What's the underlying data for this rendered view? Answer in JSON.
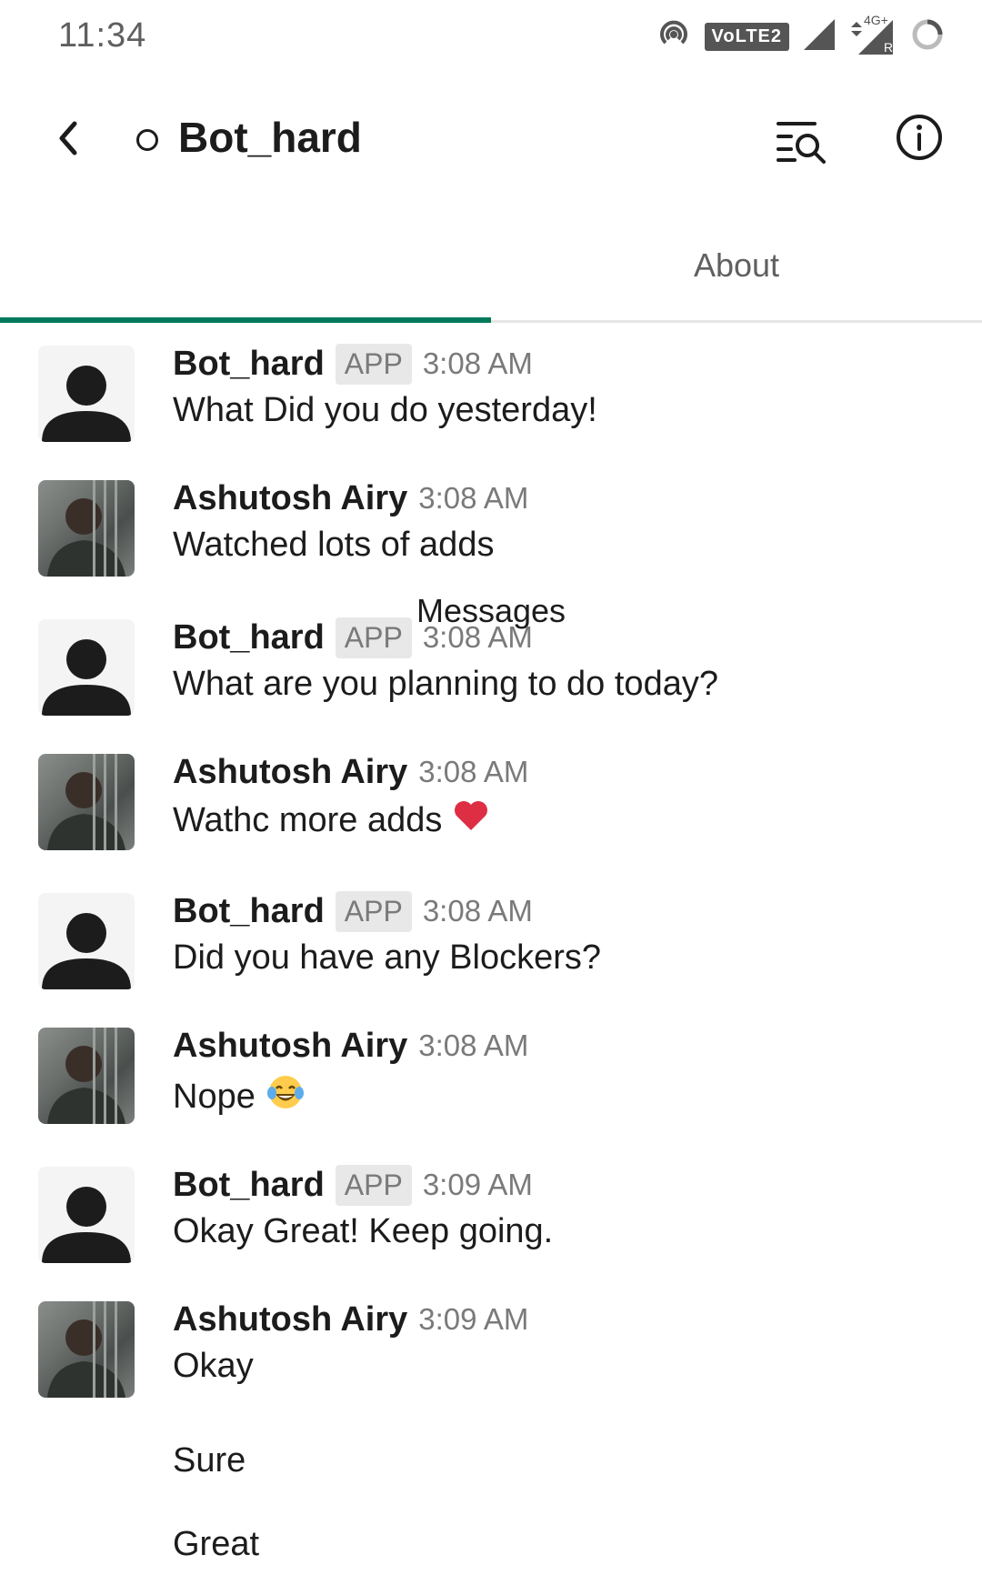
{
  "status_bar": {
    "time": "11:34",
    "volte": "VoLTE2",
    "net": "4G+",
    "roaming": "R"
  },
  "header": {
    "title": "Bot_hard"
  },
  "tabs": [
    {
      "label": "Messages"
    },
    {
      "label": "About"
    }
  ],
  "messages": [
    {
      "sender": "Bot_hard",
      "badge": "APP",
      "time": "3:08 AM",
      "text": "What Did you do yesterday!",
      "avatar": "bot"
    },
    {
      "sender": "Ashutosh Airy",
      "time": "3:08 AM",
      "text": "Watched lots of adds",
      "avatar": "photo"
    },
    {
      "sender": "Bot_hard",
      "badge": "APP",
      "time": "3:08 AM",
      "text": "What are you planning to do today?",
      "avatar": "bot"
    },
    {
      "sender": "Ashutosh Airy",
      "time": "3:08 AM",
      "text": "Wathc more adds",
      "emoji": "heart-emoji",
      "avatar": "photo"
    },
    {
      "sender": "Bot_hard",
      "badge": "APP",
      "time": "3:08 AM",
      "text": "Did you have any Blockers?",
      "avatar": "bot"
    },
    {
      "sender": "Ashutosh Airy",
      "time": "3:08 AM",
      "text": "Nope",
      "emoji": "tears-of-joy-emoji",
      "avatar": "photo"
    },
    {
      "sender": "Bot_hard",
      "badge": "APP",
      "time": "3:09 AM",
      "text": "Okay Great! Keep going.",
      "avatar": "bot"
    },
    {
      "sender": "Ashutosh Airy",
      "time": "3:09 AM",
      "text": "Okay",
      "avatar": "photo"
    }
  ],
  "continuations": [
    "Sure",
    "Great"
  ],
  "colors": {
    "accent": "#007a5a",
    "badge_bg": "#e8e8e8",
    "heart": "#dd2e44"
  }
}
